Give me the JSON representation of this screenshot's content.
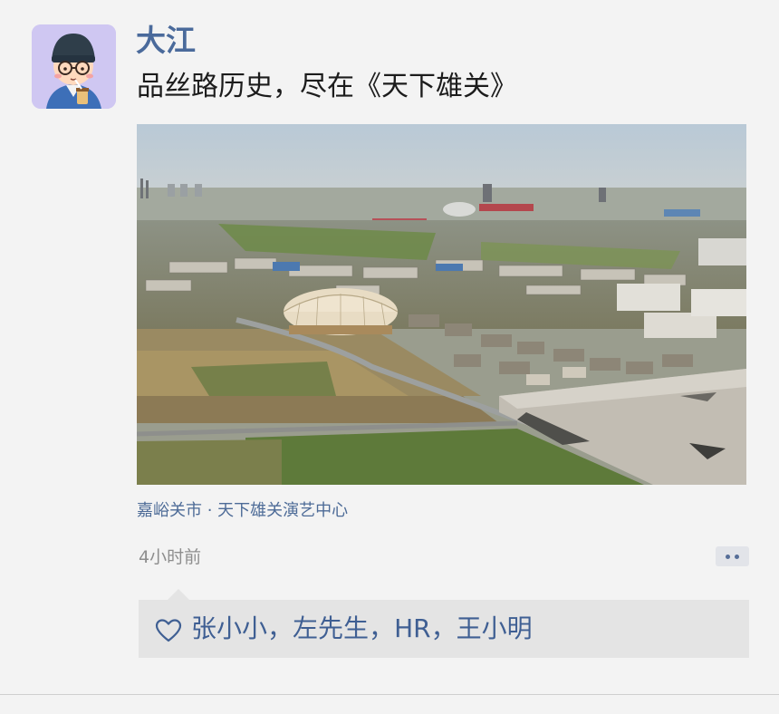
{
  "post": {
    "author": "大江",
    "text": "品丝路历史，尽在《天下雄关》",
    "location": "嘉峪关市 · 天下雄关演艺中心",
    "timestamp": "4小时前"
  },
  "likes": {
    "names": [
      "张小小",
      "左先生",
      "HR",
      "王小明"
    ],
    "separator": "，"
  },
  "colors": {
    "author": "#4a6a9b",
    "link": "#3f5f93",
    "avatar_bg": "#cfc7f2",
    "likes_bg": "#e4e4e4"
  },
  "icons": {
    "avatar": "avatar-cartoon-icon",
    "more": "more-dots-icon",
    "like": "heart-outline-icon"
  }
}
